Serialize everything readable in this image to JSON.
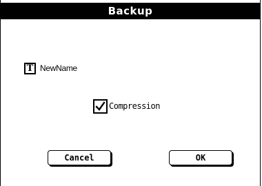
{
  "dialog": {
    "title": "Backup"
  },
  "name_field": {
    "icon": "text-T-icon",
    "value": "NewName"
  },
  "compression": {
    "label": "Compression",
    "checked": true
  },
  "buttons": {
    "cancel_label": "Cancel",
    "ok_label": "OK"
  }
}
